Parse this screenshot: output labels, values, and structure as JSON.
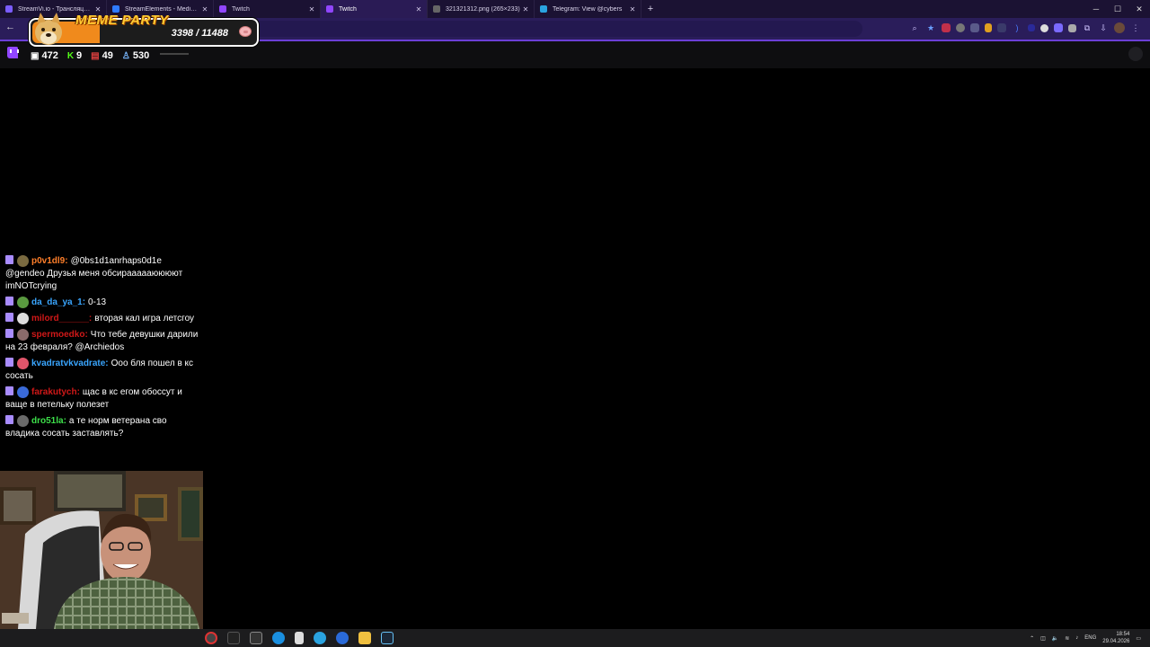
{
  "browser": {
    "tabs": [
      {
        "title": "StreamVi.io - Трансляции в не",
        "active": false,
        "fav_color": "#7b5cff"
      },
      {
        "title": "StreamElements - Media re",
        "active": false,
        "fav_color": "#2f7bff"
      },
      {
        "title": "Twitch",
        "active": false,
        "fav_color": "#9146ff"
      },
      {
        "title": "Twitch",
        "active": true,
        "fav_color": "#9146ff"
      },
      {
        "title": "321321312.png (265×233)",
        "active": false,
        "fav_color": "#666666"
      },
      {
        "title": "Telegram: View @cybers",
        "active": false,
        "fav_color": "#2aa3e0"
      }
    ],
    "new_tab": "+",
    "window_controls": {
      "minimize": "─",
      "maximize": "☐",
      "close": "✕"
    },
    "back": "←"
  },
  "widget": {
    "title": "MEME PARTY",
    "current": 3398,
    "goal": 11488,
    "count_text": "3398 / 11488",
    "progress": 0.296
  },
  "stats": {
    "viewers": "472",
    "kicks": "9",
    "likes": "49",
    "followers": "530"
  },
  "chat": [
    {
      "user": "p0v1dl9:",
      "color": "#ff7f2a",
      "text": "@0bs1d1anrhaps0d1e @gendeo Друзья меня обсираааааюююют imNOTcrying",
      "avatar": "#7a6a40"
    },
    {
      "user": "da_da_ya_1:",
      "color": "#3aa6ff",
      "text": "0-13",
      "avatar": "#5a9a40"
    },
    {
      "user": "milord______:",
      "color": "#d01818",
      "text": "вторая кал игра летсгоу",
      "avatar": "#dddddd"
    },
    {
      "user": "spermoedko:",
      "color": "#d01818",
      "text": "Что тебе девушки дарили на 23 февраля? @Archiedos",
      "avatar": "#8a6a6a"
    },
    {
      "user": "kvadratvkvadrate:",
      "color": "#3aa6ff",
      "text": "Ооо бля пошел в кс сосать",
      "avatar": "#e0556a"
    },
    {
      "user": "farakutych:",
      "color": "#d01818",
      "text": "щас в кс егом обоссут и ваще в петельку полезет",
      "avatar": "#3a6ad8"
    },
    {
      "user": "dro51la:",
      "color": "#3de04a",
      "text": "а те норм ветерана сво владика сосать заставлять?",
      "avatar": "#6a6a6a"
    }
  ],
  "taskbar": {
    "lang": "ENG",
    "time": "18:54",
    "date": "29.04.2026"
  }
}
